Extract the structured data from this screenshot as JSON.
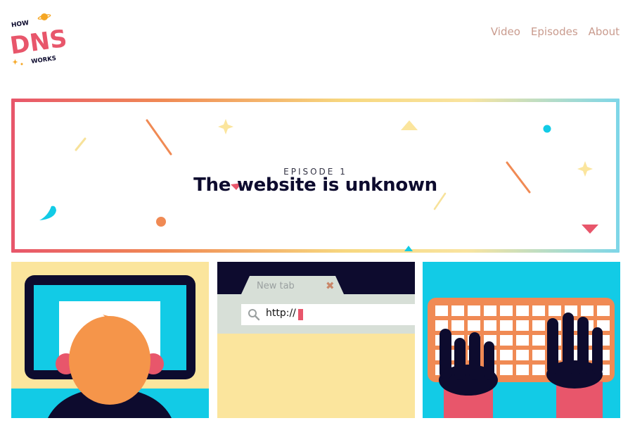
{
  "logo": {
    "line1": "HOW",
    "line2": "DNS",
    "line3": "WORKS"
  },
  "nav": {
    "items": [
      {
        "label": "Video"
      },
      {
        "label": "Episodes"
      },
      {
        "label": "About"
      }
    ]
  },
  "hero": {
    "episode": "EPISODE 1",
    "title": "The website is unknown"
  },
  "browser": {
    "tab_label": "New tab",
    "close_glyph": "✖",
    "url": "http://"
  },
  "colors": {
    "accent_red": "#e8566b",
    "accent_orange": "#f08a54",
    "accent_yellow": "#fbe59d",
    "accent_cyan": "#12cbe6",
    "navy": "#0d0b2e",
    "nav_text": "#c99b8e"
  },
  "icons": {
    "search": "search-icon",
    "close": "close-icon"
  }
}
